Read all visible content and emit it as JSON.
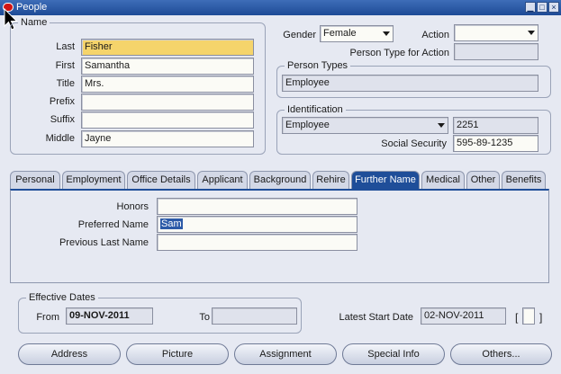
{
  "window": {
    "title": "People"
  },
  "name_group": {
    "title": "Name",
    "fields": [
      {
        "label": "Last",
        "value": "Fisher"
      },
      {
        "label": "First",
        "value": "Samantha"
      },
      {
        "label": "Title",
        "value": "Mrs."
      },
      {
        "label": "Prefix",
        "value": ""
      },
      {
        "label": "Suffix",
        "value": ""
      },
      {
        "label": "Middle",
        "value": "Jayne"
      }
    ]
  },
  "gender": {
    "label": "Gender",
    "value": "Female"
  },
  "action": {
    "label": "Action",
    "value": ""
  },
  "person_type_for_action": {
    "label": "Person Type for Action",
    "value": ""
  },
  "person_types": {
    "title": "Person Types",
    "value": "Employee"
  },
  "identification": {
    "title": "Identification",
    "type_value": "Employee",
    "number": "2251",
    "ssn_label": "Social Security",
    "ssn_value": "595-89-1235"
  },
  "tabs": [
    {
      "label": "Personal",
      "active": false
    },
    {
      "label": "Employment",
      "active": false
    },
    {
      "label": "Office Details",
      "active": false
    },
    {
      "label": "Applicant",
      "active": false
    },
    {
      "label": "Background",
      "active": false
    },
    {
      "label": "Rehire",
      "active": false
    },
    {
      "label": "Further Name",
      "active": true
    },
    {
      "label": "Medical",
      "active": false
    },
    {
      "label": "Other",
      "active": false
    },
    {
      "label": "Benefits",
      "active": false
    }
  ],
  "further_name": {
    "honors_label": "Honors",
    "honors_value": "",
    "preferred_label": "Preferred Name",
    "preferred_value": "Sam",
    "previous_last_label": "Previous Last Name",
    "previous_last_value": ""
  },
  "effective_dates": {
    "title": "Effective Dates",
    "from_label": "From",
    "from_value": "09-NOV-2011",
    "to_label": "To",
    "to_value": ""
  },
  "latest_start": {
    "label": "Latest Start Date",
    "value": "02-NOV-2011"
  },
  "bracket_field": {
    "open": "[",
    "value": "",
    "close": "]"
  },
  "buttons": {
    "address": "Address",
    "picture": "Picture",
    "assignment": "Assignment",
    "special_info": "Special Info",
    "others": "Others..."
  },
  "icons": {
    "app": "oracle-app-icon",
    "minimize": "minimize-icon",
    "maximize": "maximize-icon",
    "close": "close-icon",
    "cursor": "mouse-cursor-icon"
  }
}
